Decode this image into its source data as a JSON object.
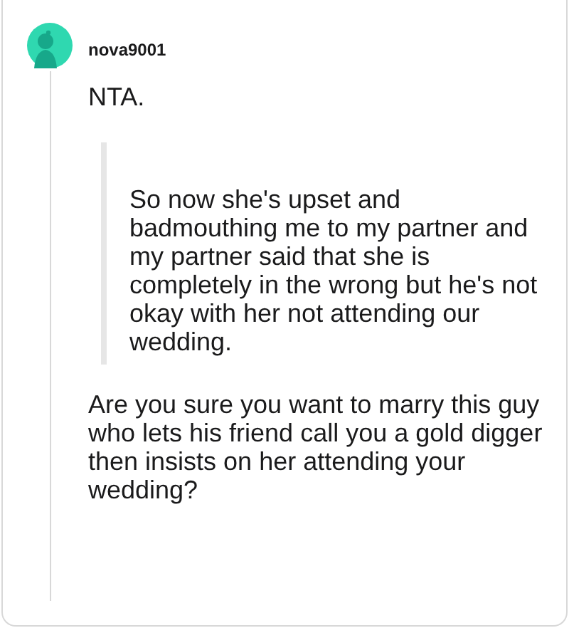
{
  "comment": {
    "author": "nova9001",
    "paragraphs": [
      {
        "kind": "text",
        "text": "NTA."
      },
      {
        "kind": "quote",
        "text": "So now she's upset and badmouthing me to my partner and my partner said that she is completely in the wrong but he's not okay with her not attending our wedding."
      },
      {
        "kind": "text",
        "text": "Are you sure you want to marry this guy who lets his friend call you a gold digger then insists on her attending your wedding?"
      }
    ]
  }
}
